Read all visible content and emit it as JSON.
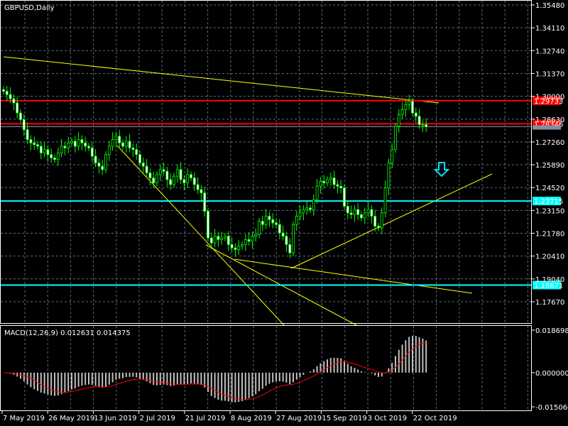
{
  "window": {
    "title": "GBPUSD,Daily"
  },
  "colors": {
    "bg": "#000000",
    "grid": "#5c6e80",
    "bull": "#00ff00",
    "candle_fill_bull": "#ffffff",
    "red_line": "#ff0000",
    "cyan_line": "#00ffff",
    "trend": "#ffff00",
    "signal": "#ff0000",
    "hist": "#c0c0c0"
  },
  "chart_data": {
    "type": "candlestick",
    "symbol": "GBPUSD",
    "timeframe": "Daily",
    "ylim": [
      1.17,
      1.356
    ],
    "price_ticks": [
      "1.35480",
      "1.34110",
      "1.32740",
      "1.31370",
      "1.30000",
      "1.28630",
      "1.27260",
      "1.25890",
      "1.24520",
      "1.23150",
      "1.21780",
      "1.20410",
      "1.19040",
      "1.17670"
    ],
    "date_ticks": [
      "7 May 2019",
      "26 May 2019",
      "13 Jun 2019",
      "2 Jul 2019",
      "21 Jul 2019",
      "8 Aug 2019",
      "27 Aug 2019",
      "15 Sep 2019",
      "3 Oct 2019",
      "22 Oct 2019"
    ],
    "closes": [
      1.303,
      1.301,
      1.2985,
      1.296,
      1.29,
      1.286,
      1.28,
      1.274,
      1.272,
      1.271,
      1.27,
      1.266,
      1.268,
      1.265,
      1.263,
      1.262,
      1.266,
      1.27,
      1.269,
      1.272,
      1.273,
      1.27,
      1.274,
      1.272,
      1.27,
      1.269,
      1.264,
      1.26,
      1.258,
      1.256,
      1.265,
      1.27,
      1.274,
      1.276,
      1.272,
      1.27,
      1.273,
      1.269,
      1.268,
      1.265,
      1.26,
      1.258,
      1.254,
      1.251,
      1.248,
      1.253,
      1.256,
      1.255,
      1.25,
      1.247,
      1.252,
      1.256,
      1.25,
      1.248,
      1.253,
      1.251,
      1.247,
      1.244,
      1.242,
      1.231,
      1.215,
      1.212,
      1.216,
      1.214,
      1.215,
      1.216,
      1.211,
      1.209,
      1.208,
      1.21,
      1.211,
      1.214,
      1.213,
      1.216,
      1.217,
      1.225,
      1.223,
      1.228,
      1.226,
      1.224,
      1.223,
      1.218,
      1.216,
      1.211,
      1.206,
      1.223,
      1.228,
      1.23,
      1.232,
      1.233,
      1.232,
      1.238,
      1.246,
      1.249,
      1.248,
      1.25,
      1.251,
      1.247,
      1.246,
      1.245,
      1.234,
      1.23,
      1.229,
      1.232,
      1.229,
      1.227,
      1.23,
      1.232,
      1.228,
      1.222,
      1.221,
      1.23,
      1.245,
      1.26,
      1.268,
      1.282,
      1.289,
      1.292,
      1.295,
      1.297,
      1.29,
      1.288,
      1.283,
      1.283,
      1.2817
    ],
    "levels": [
      {
        "price": 1.29733,
        "label": "1.29733",
        "color": "#ff0000"
      },
      {
        "price": 1.28346,
        "label": "1.28346",
        "color": "#ff0000"
      },
      {
        "price": 1.23715,
        "label": "1.23715",
        "color": "#00ffff"
      },
      {
        "price": 1.18671,
        "label": "1.18671",
        "color": "#00ffff"
      }
    ],
    "bid_price": 1.2817,
    "macd": {
      "label": "MACD(12,26,9) 0.012631 0.014375",
      "ticks": [
        "0.018698",
        "0.000000",
        "-0.015060"
      ],
      "ylim": [
        -0.01506,
        0.018698
      ]
    }
  }
}
